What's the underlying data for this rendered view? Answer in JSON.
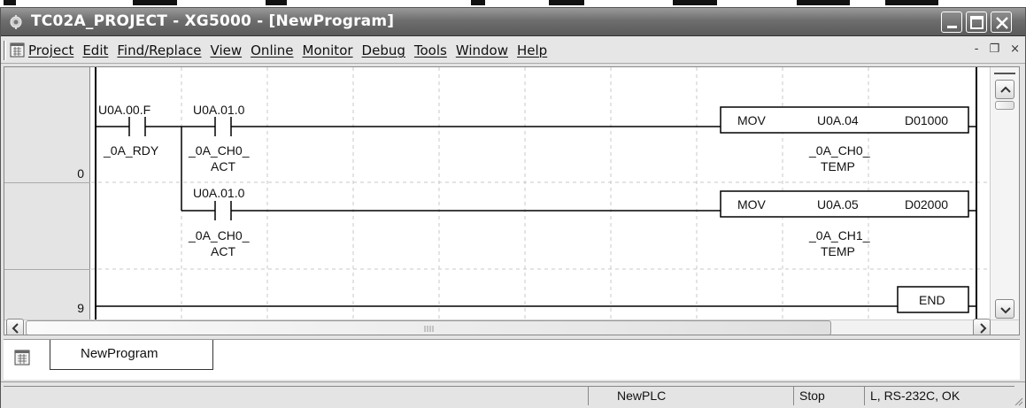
{
  "window": {
    "title": "TC02A_PROJECT - XG5000 - [NewProgram]",
    "icon": "app-icon"
  },
  "menu": {
    "items": [
      "Project",
      "Edit",
      "Find/Replace",
      "View",
      "Online",
      "Monitor",
      "Debug",
      "Tools",
      "Window",
      "Help"
    ],
    "mdi_buttons": [
      "-",
      "❐",
      "×"
    ]
  },
  "ladder": {
    "steps": [
      {
        "number": "0"
      },
      {
        "number": "9"
      }
    ],
    "rung0": {
      "contact1": {
        "address": "U0A.00.F",
        "comment": "_0A_RDY"
      },
      "contact2": {
        "address": "U0A.01.0",
        "comment1": "_0A_CH0_",
        "comment2": "ACT"
      },
      "mov1": {
        "op": "MOV",
        "src": "U0A.04",
        "dst": "D01000",
        "src_comment1": "_0A_CH0_",
        "src_comment2": "TEMP"
      },
      "contact3": {
        "address": "U0A.01.0",
        "comment1": "_0A_CH0_",
        "comment2": "ACT"
      },
      "mov2": {
        "op": "MOV",
        "src": "U0A.05",
        "dst": "D02000",
        "src_comment1": "_0A_CH1_",
        "src_comment2": "TEMP"
      }
    },
    "rung9": {
      "op": "END"
    }
  },
  "tabs": [
    {
      "label": "NewProgram",
      "icon": "program-icon",
      "active": true
    }
  ],
  "status": {
    "plc": "NewPLC",
    "mode": "Stop",
    "connection": "L, RS-232C, OK"
  }
}
